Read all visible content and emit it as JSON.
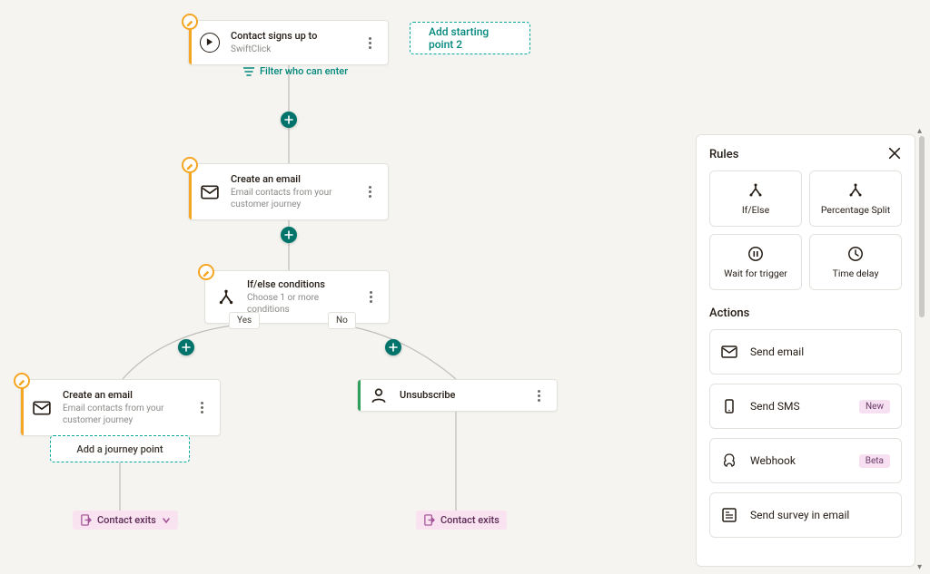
{
  "colors": {
    "teal": "#00a79d",
    "orange": "#f5a623",
    "green": "#2e9e5b",
    "exitBg": "#f9e3f0"
  },
  "canvas": {
    "start_pill_label": "Add starting point 2",
    "filter_link_label": "Filter who can enter",
    "add_journey_label": "Add a journey point",
    "branch_yes": "Yes",
    "branch_no": "No",
    "exit_label": "Contact exits",
    "nodes": {
      "start": {
        "title": "Contact signs up to",
        "sub": "SwiftClick"
      },
      "email1": {
        "title": "Create an email",
        "sub": "Email contacts from your customer journey"
      },
      "ifelse": {
        "title": "If/else conditions",
        "sub": "Choose 1 or more conditions"
      },
      "email2": {
        "title": "Create an email",
        "sub": "Email contacts from your customer journey"
      },
      "unsub": {
        "title": "Unsubscribe"
      }
    }
  },
  "panel": {
    "rules_title": "Rules",
    "actions_title": "Actions",
    "rules": [
      {
        "id": "ifelse",
        "label": "If/Else"
      },
      {
        "id": "split",
        "label": "Percentage Split"
      },
      {
        "id": "wait",
        "label": "Wait for trigger"
      },
      {
        "id": "delay",
        "label": "Time delay"
      }
    ],
    "actions": [
      {
        "id": "send_email",
        "label": "Send email",
        "badge": null
      },
      {
        "id": "send_sms",
        "label": "Send SMS",
        "badge": "New"
      },
      {
        "id": "webhook",
        "label": "Webhook",
        "badge": "Beta"
      },
      {
        "id": "survey",
        "label": "Send survey in email",
        "badge": null
      }
    ]
  }
}
